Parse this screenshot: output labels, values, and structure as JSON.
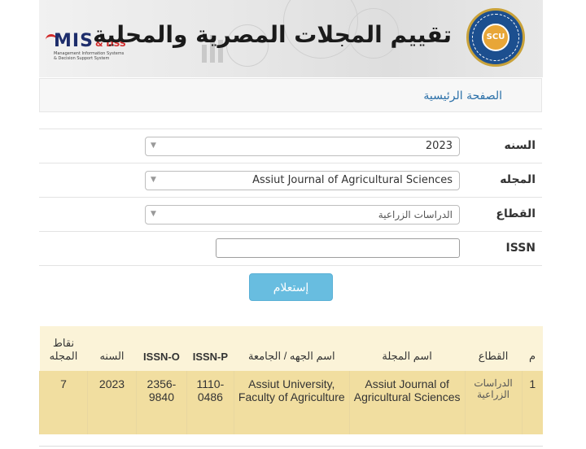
{
  "banner": {
    "title": "تقييم المجلات المصرية والمحلية",
    "logo_main": "MIS",
    "logo_suffix": "& DSS",
    "logo_sub1": "Management Information Systems",
    "logo_sub2": "& Decision Support System",
    "seal_text": "SCU"
  },
  "breadcrumb": {
    "home": "الصفحة الرئيسية"
  },
  "form": {
    "year_label": "السنه",
    "year_value": "2023",
    "journal_label": "المجله",
    "journal_value": "Assiut Journal of Agricultural Sciences",
    "sector_label": "القطاع",
    "sector_value": "الدراسات الزراعية",
    "issn_label": "ISSN",
    "issn_value": "",
    "submit_label": "إستعلام"
  },
  "table": {
    "headers": {
      "num": "م",
      "sector": "القطاع",
      "journal": "اسم المجلة",
      "institution": "اسم الجهه / الجامعة",
      "issn_p": "ISSN-P",
      "issn_o": "ISSN-O",
      "year": "السنه",
      "points": "نقاط المجله"
    },
    "rows": [
      {
        "num": "1",
        "sector": "الدراسات الزراعية",
        "journal": "Assiut Journal of Agricultural Sciences",
        "institution": "Assiut University, Faculty of Agriculture",
        "issn_p": "1110-0486",
        "issn_o": "2356-9840",
        "year": "2023",
        "points": "7"
      }
    ]
  },
  "colors": {
    "link": "#2a6fa8",
    "button": "#68bde0",
    "table_header": "#fbf3d8",
    "table_row": "#f1dea0"
  }
}
